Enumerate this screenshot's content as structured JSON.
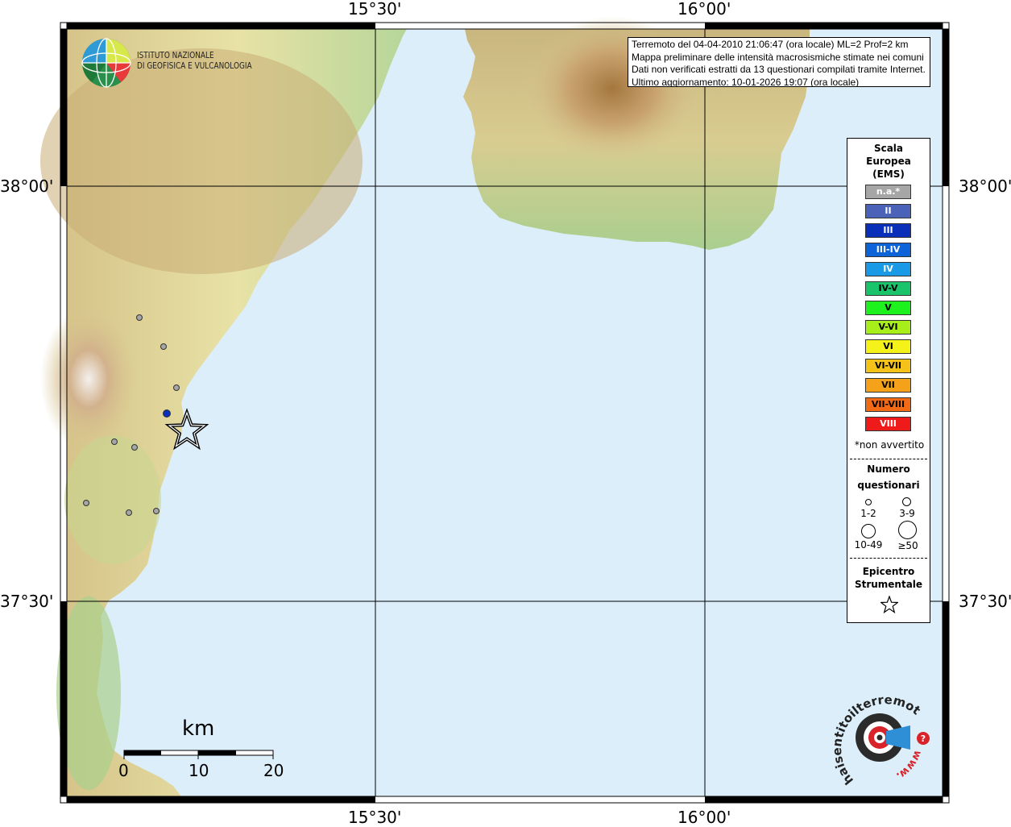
{
  "map": {
    "lon_labels": [
      "15°30'",
      "16°00'"
    ],
    "lat_labels": [
      "38°00'",
      "37°30'"
    ]
  },
  "info_box": {
    "lines": [
      "Terremoto del 04-04-2010 21:06:47 (ora locale) ML=2 Prof=2 km",
      "Mappa preliminare delle intensità macrosismiche stimate nei comuni",
      "Dati non verificati estratti da 13 questionari compilati tramite Internet.",
      "Ultimo aggiornamento: 10-01-2026 19:07 (ora locale)"
    ]
  },
  "institute": {
    "line1": "ISTITUTO NAZIONALE",
    "line2": "DI GEOFISICA E VULCANOLOGIA"
  },
  "legend": {
    "title": [
      "Scala",
      "Europea",
      "(EMS)"
    ],
    "classes": [
      {
        "label": "n.a.*",
        "color": "#a6a6a6",
        "text_color": "#ffffff"
      },
      {
        "label": "II",
        "color": "#4a63b8",
        "text_color": "#ffffff"
      },
      {
        "label": "III",
        "color": "#0a2fb8",
        "text_color": "#ffffff"
      },
      {
        "label": "III-IV",
        "color": "#0d64d8",
        "text_color": "#ffffff"
      },
      {
        "label": "IV",
        "color": "#1a9ae6",
        "text_color": "#ffffff"
      },
      {
        "label": "IV-V",
        "color": "#19c46a",
        "text_color": "#000000"
      },
      {
        "label": "V",
        "color": "#1ef21e",
        "text_color": "#000000"
      },
      {
        "label": "V-VI",
        "color": "#a8ee1a",
        "text_color": "#000000"
      },
      {
        "label": "VI",
        "color": "#f5f21a",
        "text_color": "#000000"
      },
      {
        "label": "VI-VII",
        "color": "#f5c21a",
        "text_color": "#000000"
      },
      {
        "label": "VII",
        "color": "#f5a21a",
        "text_color": "#000000"
      },
      {
        "label": "VII-VIII",
        "color": "#f26b14",
        "text_color": "#000000"
      },
      {
        "label": "VIII",
        "color": "#ef1a1a",
        "text_color": "#ffffff"
      }
    ],
    "not_felt_note": "*non avvertito",
    "questionnaires_title": [
      "Numero",
      "questionari"
    ],
    "questionnaire_sizes": [
      "1-2",
      "3-9",
      "10-49",
      "≥50"
    ],
    "epicenter_title": [
      "Epicentro",
      "Strumentale"
    ]
  },
  "scale_bar": {
    "unit": "km",
    "ticks": [
      "0",
      "10",
      "20"
    ]
  },
  "observations": {
    "not_felt_count": 10,
    "felt_II_count": 1,
    "epicenter": "Epicentro Strumentale"
  },
  "brand": {
    "text": "haisentitoilterremoto.it",
    "url": "www."
  }
}
